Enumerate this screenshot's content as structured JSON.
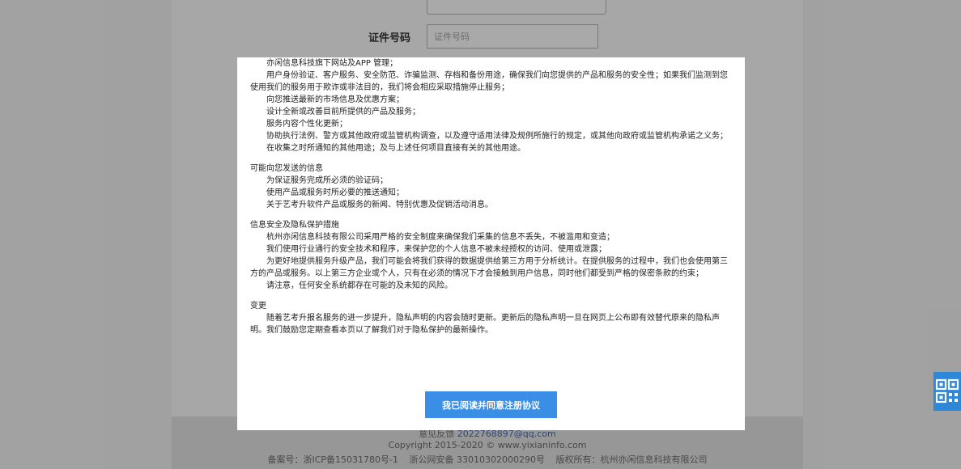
{
  "form": {
    "id_label": "证件号码",
    "id_placeholder": "证件号码"
  },
  "modal": {
    "paragraphs": [
      {
        "type": "item",
        "text": "亦闲信息科技旗下网站及APP 管理；"
      },
      {
        "type": "item",
        "text": "用户身份验证、客户服务、安全防范、诈骗监测、存档和备份用途，确保我们向您提供的产品和服务的安全性；如果我们监测到您使用我们的服务用于欺诈或非法目的，我们将会相应采取措施停止服务；"
      },
      {
        "type": "item",
        "text": "向您推送最新的市场信息及优惠方案；"
      },
      {
        "type": "item",
        "text": "设计全新或改善目前所提供的产品及服务；"
      },
      {
        "type": "item",
        "text": "服务内容个性化更新；"
      },
      {
        "type": "item",
        "text": "协助执行法例、警方或其他政府或监管机构调查，以及遵守适用法律及规例所施行的规定，或其他向政府或监管机构承诺之义务；"
      },
      {
        "type": "item",
        "text": "在收集之时所通知的其他用途；及与上述任何项目直接有关的其他用途。"
      },
      {
        "type": "title",
        "text": "可能向您发送的信息"
      },
      {
        "type": "item",
        "text": "为保证服务完成所必须的验证码；"
      },
      {
        "type": "item",
        "text": "使用产品或服务时所必要的推送通知；"
      },
      {
        "type": "item",
        "text": "关于艺考升软件产品或服务的新闻、特别优惠及促销活动消息。"
      },
      {
        "type": "title",
        "text": "信息安全及隐私保护措施"
      },
      {
        "type": "item",
        "text": "杭州亦闲信息科技有限公司采用严格的安全制度来确保我们采集的信息不丢失，不被滥用和变造；"
      },
      {
        "type": "item",
        "text": "我们使用行业通行的安全技术和程序，来保护您的个人信息不被未经授权的访问、使用或泄露；"
      },
      {
        "type": "item",
        "text": "为更好地提供服务升级产品，我们可能会将我们获得的数据提供给第三方用于分析统计。在提供服务的过程中，我们也会使用第三方的产品或服务。以上第三方企业或个人，只有在必须的情况下才会接触到用户信息，同时他们都受到严格的保密条款的约束；"
      },
      {
        "type": "item",
        "text": "请注意，任何安全系统都存在可能的及未知的风险。"
      },
      {
        "type": "title",
        "text": "变更"
      },
      {
        "type": "item",
        "text": "随着艺考升报名服务的进一步提升，隐私声明的内容会随时更新。更新后的隐私声明一旦在网页上公布即有效替代原来的隐私声明。我们鼓励您定期查看本页以了解我们对于隐私保护的最新操作。"
      }
    ],
    "agree_label": "我已阅读并同意注册协议"
  },
  "footer": {
    "feedback_label": "意见反馈",
    "feedback_email": "2022768897@qq.com",
    "copyright": "Copyright  2015-2020 © www.yixianinfo.com",
    "icp": "备案号：浙ICP备15031780号-1",
    "police": "浙公网安备 33010302000290号",
    "rights": "版权所有：杭州亦闲信息科技有限公司"
  },
  "icons": {
    "side_widget": "qr-code-icon"
  },
  "colors": {
    "primary": "#3a8ee6",
    "widget": "#2f87d8"
  }
}
